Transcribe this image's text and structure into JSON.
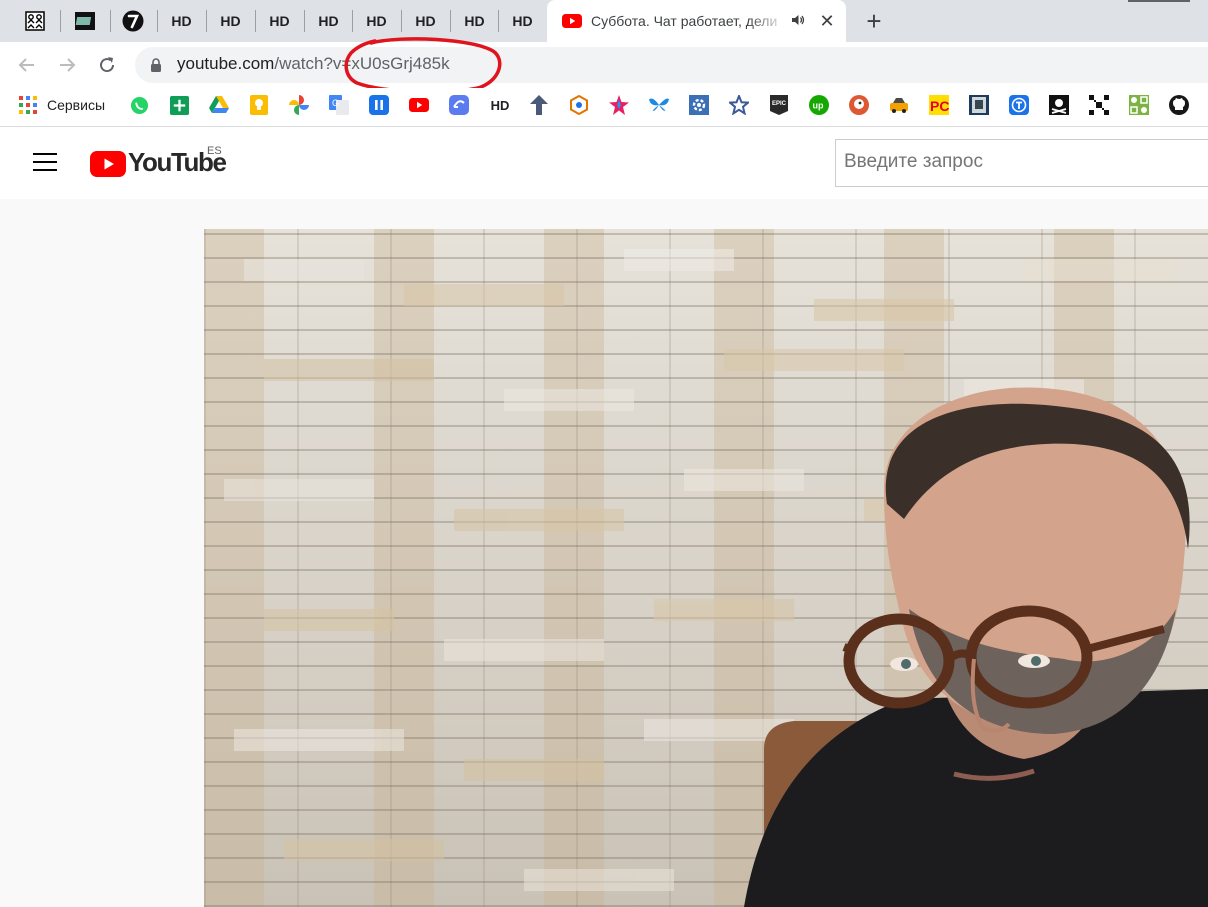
{
  "browser": {
    "hd_tab_label": "HD",
    "active_tab": {
      "title": "Суббота. Чат работает, дели",
      "favicon": "youtube-icon"
    },
    "new_tab_label": "+",
    "address_bar": {
      "url_host": "youtube.com",
      "url_path": "/watch?v=xU0sGrj485k",
      "annotation_color": "#e0141c"
    },
    "bookmarks": {
      "apps_label": "Сервисы",
      "hd_label": "HD",
      "epic_label": "EPIC",
      "up_label": "up",
      "pc_label": "PC"
    }
  },
  "youtube": {
    "logo_text": "YouTube",
    "country_code": "ES",
    "search_placeholder": "Введите запрос",
    "brand_color": "#ff0000"
  }
}
